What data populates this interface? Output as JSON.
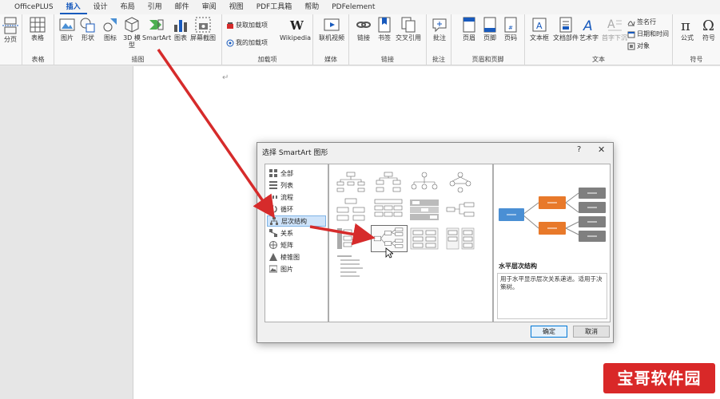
{
  "tabs": [
    "OfficePLUS",
    "插入",
    "设计",
    "布局",
    "引用",
    "邮件",
    "审阅",
    "视图",
    "PDF工具箱",
    "帮助",
    "PDFelement"
  ],
  "active_tab": 1,
  "ribbon": {
    "page_break": "分页",
    "table": "表格",
    "table_group": "表格",
    "picture": "图片",
    "shapes": "形状",
    "icons": "图标",
    "models_3d": "3D 模型",
    "smartart": "SmartArt",
    "chart": "图表",
    "screenshot": "屏幕截图",
    "illustrations_group": "插图",
    "get_addins": "获取加载项",
    "my_addins": "我的加载项",
    "wikipedia": "Wikipedia",
    "addins_group": "加载项",
    "online_video": "联机视频",
    "media_group": "媒体",
    "link": "链接",
    "bookmark": "书签",
    "cross_ref": "交叉引用",
    "links_group": "链接",
    "comment": "批注",
    "comment_group": "批注",
    "header": "页眉",
    "footer": "页脚",
    "page_number": "页码",
    "header_footer_group": "页眉和页脚",
    "textbox": "文本框",
    "quick_parts": "文档部件",
    "wordart": "艺术字",
    "drop_cap": "首字下沉",
    "signature_line": "签名行",
    "date_time": "日期和时间",
    "object": "对象",
    "text_group": "文本",
    "equation": "公式",
    "symbol": "符号",
    "symbols_group": "符号"
  },
  "document": {
    "para_mark": "↵"
  },
  "dialog": {
    "title": "选择 SmartArt 图形",
    "help": "?",
    "close": "✕",
    "categories": [
      "全部",
      "列表",
      "流程",
      "循环",
      "层次结构",
      "关系",
      "矩阵",
      "棱锥图",
      "图片"
    ],
    "selected_category": 4,
    "preview_title": "水平层次结构",
    "preview_desc": "用于水平显示层次关系递进。适用于决策树。",
    "ok": "确定",
    "cancel": "取消"
  },
  "watermark": "宝哥软件园",
  "colors": {
    "accent": "#185abd",
    "blue_box": "#4a8fd4",
    "orange_box": "#e8792a",
    "gray_box": "#7f7f7f",
    "arrow": "#d62b2b"
  }
}
